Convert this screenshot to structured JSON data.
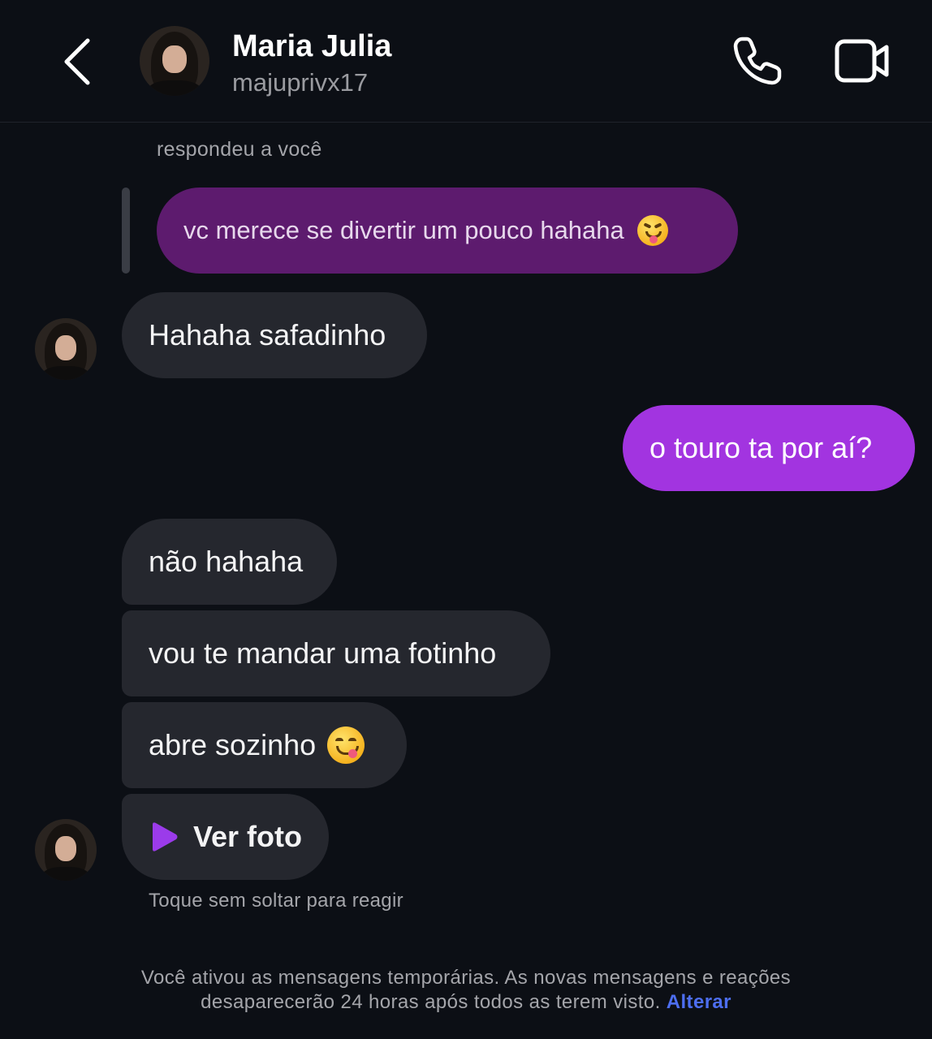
{
  "header": {
    "name": "Maria Julia",
    "username": "majuprivx17"
  },
  "reply": {
    "label": "respondeu a você",
    "quoted_text": "vc merece se divertir um pouco hahaha",
    "quoted_emoji": "squinting-face-with-tongue"
  },
  "messages": [
    {
      "side": "in",
      "text": "Hahaha safadinho"
    },
    {
      "side": "out",
      "text": "o touro ta por aí?"
    },
    {
      "side": "in",
      "text": "não hahaha"
    },
    {
      "side": "in",
      "text": "vou te mandar uma fotinho"
    },
    {
      "side": "in",
      "text": "abre sozinho",
      "emoji": "face-savoring-food"
    },
    {
      "side": "in",
      "text": "Ver foto",
      "type": "view-once-photo"
    }
  ],
  "hint": "Toque sem soltar para reagir",
  "footer": {
    "line1": "Você ativou as mensagens temporárias. As novas mensagens e reações",
    "line2": "desaparecerão 24 horas após todos as terem visto.",
    "link": "Alterar"
  },
  "colors": {
    "background": "#0c0f15",
    "incoming_bubble": "#25272e",
    "outgoing_bubble": "#a234e0",
    "quoted_bubble": "#5d1b6e",
    "link": "#4d6ef0",
    "play_icon": "#9b3bea"
  }
}
